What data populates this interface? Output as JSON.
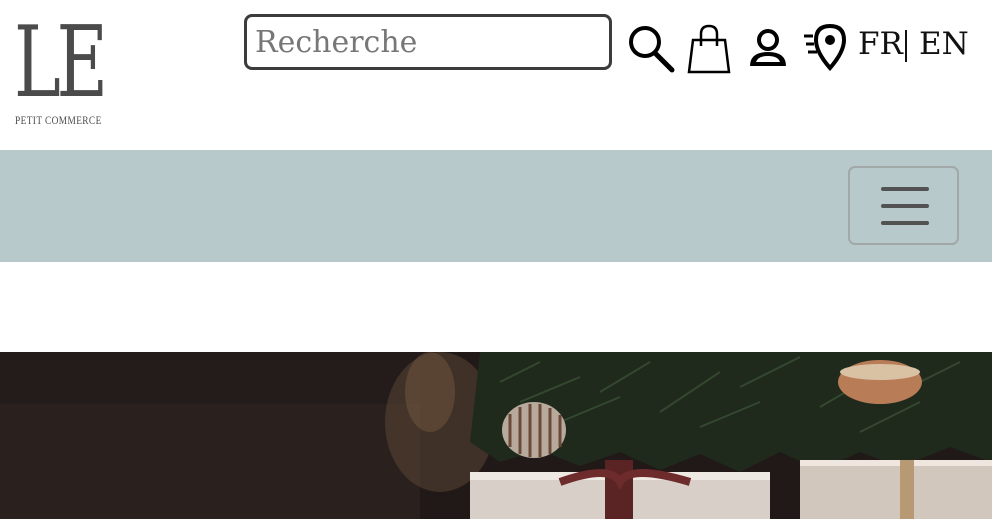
{
  "header": {
    "logo": {
      "mark": "LE",
      "subtitle": "PETIT COMMERCE"
    },
    "search": {
      "placeholder": "Recherche"
    },
    "icons": [
      "search-icon",
      "shopping-bag-icon",
      "user-icon",
      "store-locator-icon"
    ],
    "languages": {
      "fr": "FR",
      "en": "EN"
    }
  },
  "nav": {
    "background_color": "#b7c9cb",
    "menu_icon": "hamburger-menu-icon"
  },
  "hero": {
    "description_icon": "holiday-gifts-photo"
  }
}
